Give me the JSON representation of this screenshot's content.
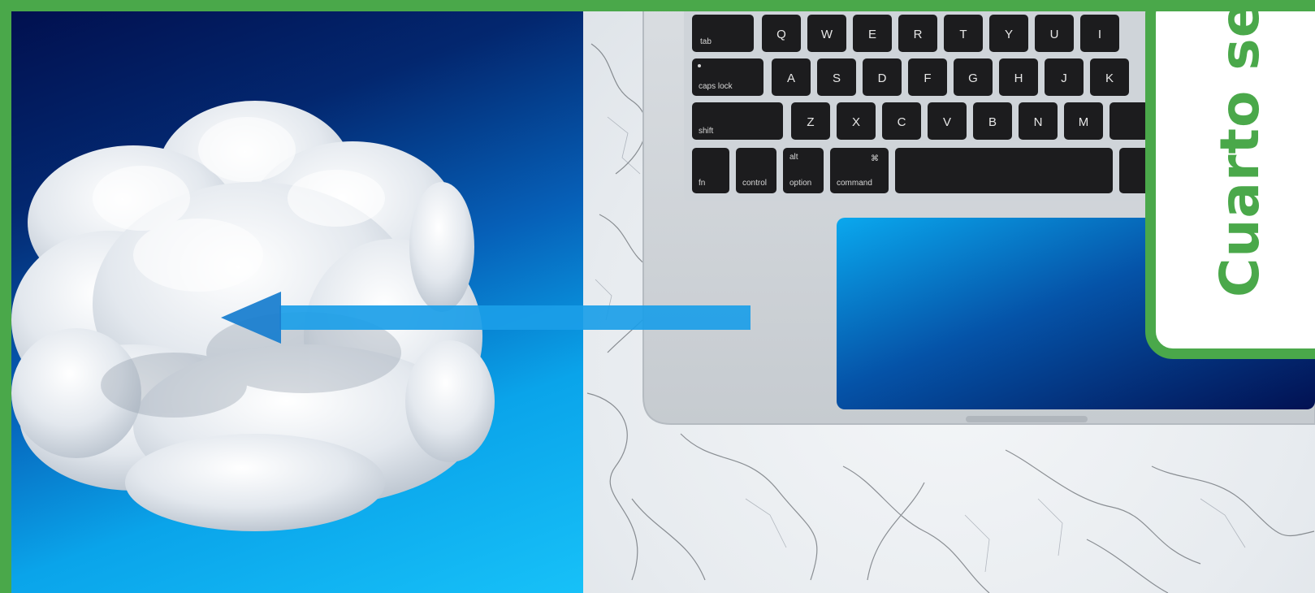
{
  "card": {
    "title": "Cuarto se"
  },
  "keyboard": {
    "row1": [
      "tab",
      "Q",
      "W",
      "E",
      "R",
      "T",
      "Y",
      "U",
      "I"
    ],
    "row2": [
      "caps lock",
      "A",
      "S",
      "D",
      "F",
      "G",
      "H",
      "J",
      "K"
    ],
    "row3": [
      "shift",
      "Z",
      "X",
      "C",
      "V",
      "B",
      "N",
      "M"
    ],
    "row4": [
      "fn",
      "control",
      "option",
      "command"
    ],
    "alt_symbol": "alt",
    "cmd_symbol": "⌘"
  },
  "colors": {
    "frame": "#4aa84a",
    "sky_dark": "#01104f",
    "sky_light": "#17c1f8",
    "arrow": "#1b9ee8"
  }
}
